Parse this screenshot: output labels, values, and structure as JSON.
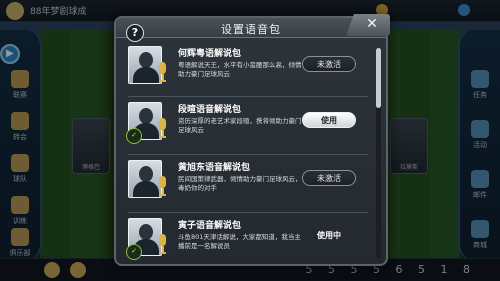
{
  "background": {
    "topbar_text": "88年梦剧球成",
    "side_left": [
      "联赛",
      "转会",
      "球队",
      "训练",
      "俱乐部"
    ],
    "side_right": [
      "任务",
      "活动",
      "邮件",
      "商城"
    ],
    "bottom_digits": "5 5 5 5 6 5 1 8",
    "cards": [
      "博格巴",
      "拉莫斯"
    ]
  },
  "dialog": {
    "title": "设置语音包",
    "help_label": "?",
    "close_label": "✕",
    "packs": [
      {
        "name": "何辉粤语解说包",
        "description": "粤语解说天王，水平有小蛮腰那么高，倾情助力豪门足球风云",
        "button": "未激活",
        "state": "inactive",
        "owned": false
      },
      {
        "name": "段暄语音解说包",
        "description": "资历深厚的老艺术家段暄，携将倾助力豪门足球风云",
        "button": "使用",
        "state": "use",
        "owned": true
      },
      {
        "name": "黄旭东语音解说包",
        "description": "民间国策律武器，倾情助力豪门足球风云，毒奶你的对手",
        "button": "未激活",
        "state": "inactive",
        "owned": false
      },
      {
        "name": "寅子语音解说包",
        "description": "斗鱼801天津话解说，大家都知道，我当主播前是一名解说员",
        "button": "使用中",
        "state": "inuse",
        "owned": true
      }
    ]
  }
}
